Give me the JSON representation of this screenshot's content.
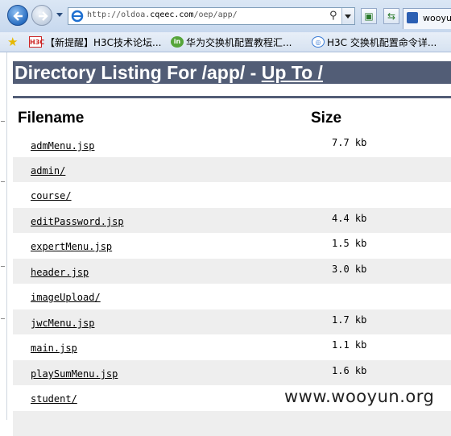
{
  "browser": {
    "address": {
      "prefix": "http://oldoa.",
      "domain": "cqeec.com",
      "path": "/oep/app/"
    },
    "tab_label": "wooyun"
  },
  "favorites": [
    {
      "label": "【新提醒】H3C技术论坛...",
      "icon": "h3c-icon"
    },
    {
      "label": "华为交换机配置教程汇...",
      "icon": "huawei-icon"
    },
    {
      "label": "H3C 交换机配置命令详...",
      "icon": "search-icon"
    }
  ],
  "page": {
    "heading_prefix": "Directory Listing For /app/ - ",
    "heading_link": "Up To /",
    "col_filename": "Filename",
    "col_size": "Size",
    "rows": [
      {
        "name": "admMenu.jsp",
        "size": "7.7 kb"
      },
      {
        "name": "admin/",
        "size": ""
      },
      {
        "name": "course/",
        "size": ""
      },
      {
        "name": "editPassword.jsp",
        "size": "4.4 kb"
      },
      {
        "name": "expertMenu.jsp",
        "size": "1.5 kb"
      },
      {
        "name": "header.jsp",
        "size": "3.0 kb"
      },
      {
        "name": "imageUpload/",
        "size": ""
      },
      {
        "name": "jwcMenu.jsp",
        "size": "1.7 kb"
      },
      {
        "name": "main.jsp",
        "size": "1.1 kb"
      },
      {
        "name": "playSumMenu.jsp",
        "size": "1.6 kb"
      },
      {
        "name": "student/",
        "size": ""
      }
    ]
  },
  "watermark": "www.wooyun.org"
}
